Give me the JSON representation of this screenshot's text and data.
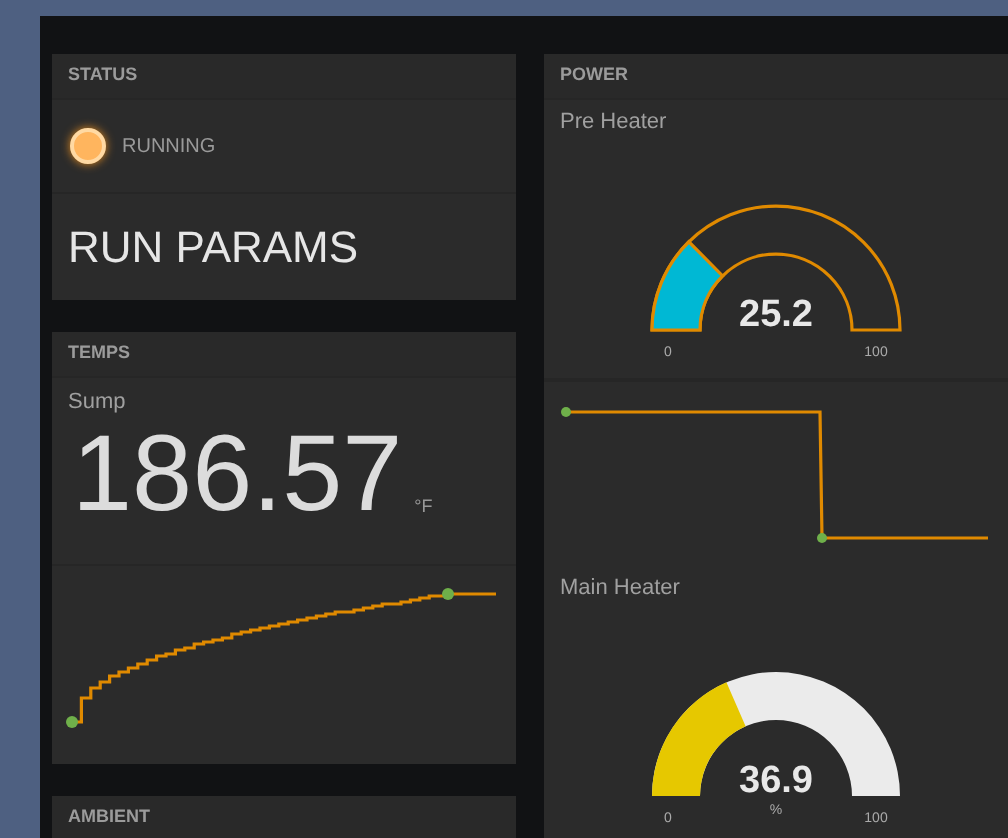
{
  "status": {
    "title": "STATUS",
    "light": {
      "on": true,
      "label": "RUNNING"
    },
    "heading": "RUN PARAMS"
  },
  "temps": {
    "title": "TEMPS",
    "label": "Sump",
    "value": "186.57",
    "unit": "°F"
  },
  "ambient": {
    "title": "AMBIENT"
  },
  "power": {
    "title": "POWER",
    "gauges": [
      {
        "label": "Pre Heater",
        "kind": "outline",
        "value": "25.2",
        "min": "0",
        "max": "100"
      },
      {
        "label": "Main Heater",
        "kind": "solid",
        "value": "36.9",
        "unit": "%",
        "min": "0",
        "max": "100"
      }
    ]
  }
}
